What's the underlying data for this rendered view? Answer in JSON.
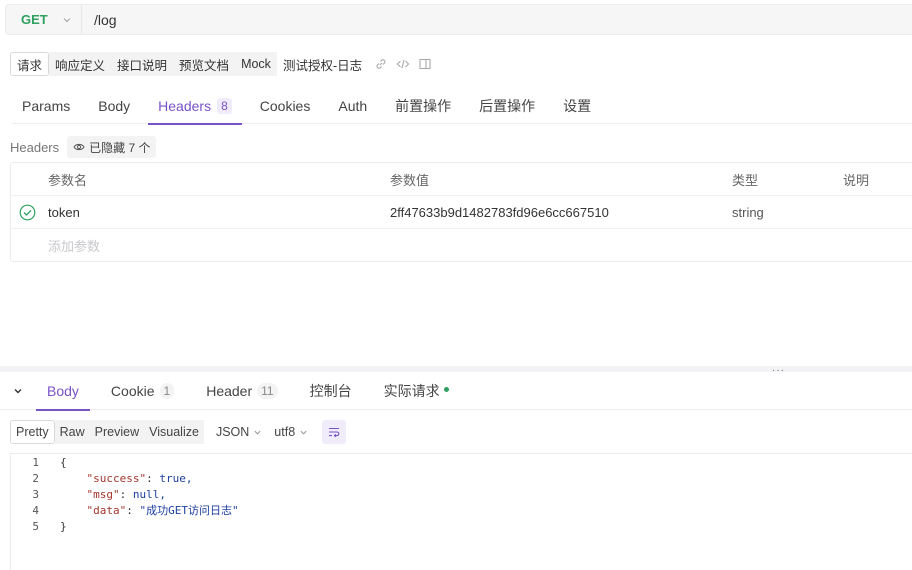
{
  "request": {
    "method": "GET",
    "url": "/log"
  },
  "subtabs": [
    "请求",
    "响应定义",
    "接口说明",
    "预览文档",
    "Mock"
  ],
  "api_name": "测试授权-日志",
  "tabs": [
    {
      "label": "Params"
    },
    {
      "label": "Body"
    },
    {
      "label": "Headers",
      "badge": "8"
    },
    {
      "label": "Cookies"
    },
    {
      "label": "Auth"
    },
    {
      "label": "前置操作"
    },
    {
      "label": "后置操作"
    },
    {
      "label": "设置"
    }
  ],
  "headers_section": {
    "label": "Headers",
    "hidden_text": "已隐藏 7 个"
  },
  "params_table": {
    "columns": [
      "参数名",
      "参数值",
      "类型",
      "说明"
    ],
    "rows": [
      {
        "name": "token",
        "value": "2ff47633b9d1482783fd96e6cc667510",
        "type": "string",
        "desc": ""
      }
    ],
    "add_placeholder": "添加参数"
  },
  "divider_handle": "···",
  "response_tabs": [
    {
      "label": "Body"
    },
    {
      "label": "Cookie",
      "count": "1"
    },
    {
      "label": "Header",
      "count": "11"
    },
    {
      "label": "控制台"
    },
    {
      "label": "实际请求"
    }
  ],
  "format_buttons": [
    "Pretty",
    "Raw",
    "Preview",
    "Visualize"
  ],
  "format_select": "JSON",
  "encoding_select": "utf8",
  "code_lines": [
    {
      "n": "1",
      "text": "{"
    },
    {
      "n": "2",
      "key": "\"success\"",
      "sep": ": ",
      "val": "true,"
    },
    {
      "n": "3",
      "key": "\"msg\"",
      "sep": ": ",
      "val": "null,"
    },
    {
      "n": "4",
      "key": "\"data\"",
      "sep": ": ",
      "val": "\"成功GET访问日志\""
    },
    {
      "n": "5",
      "text": "}"
    }
  ],
  "colors": {
    "accent": "#7a52c7",
    "method": "#2ea05f",
    "status_dot": "#2ea05f"
  }
}
